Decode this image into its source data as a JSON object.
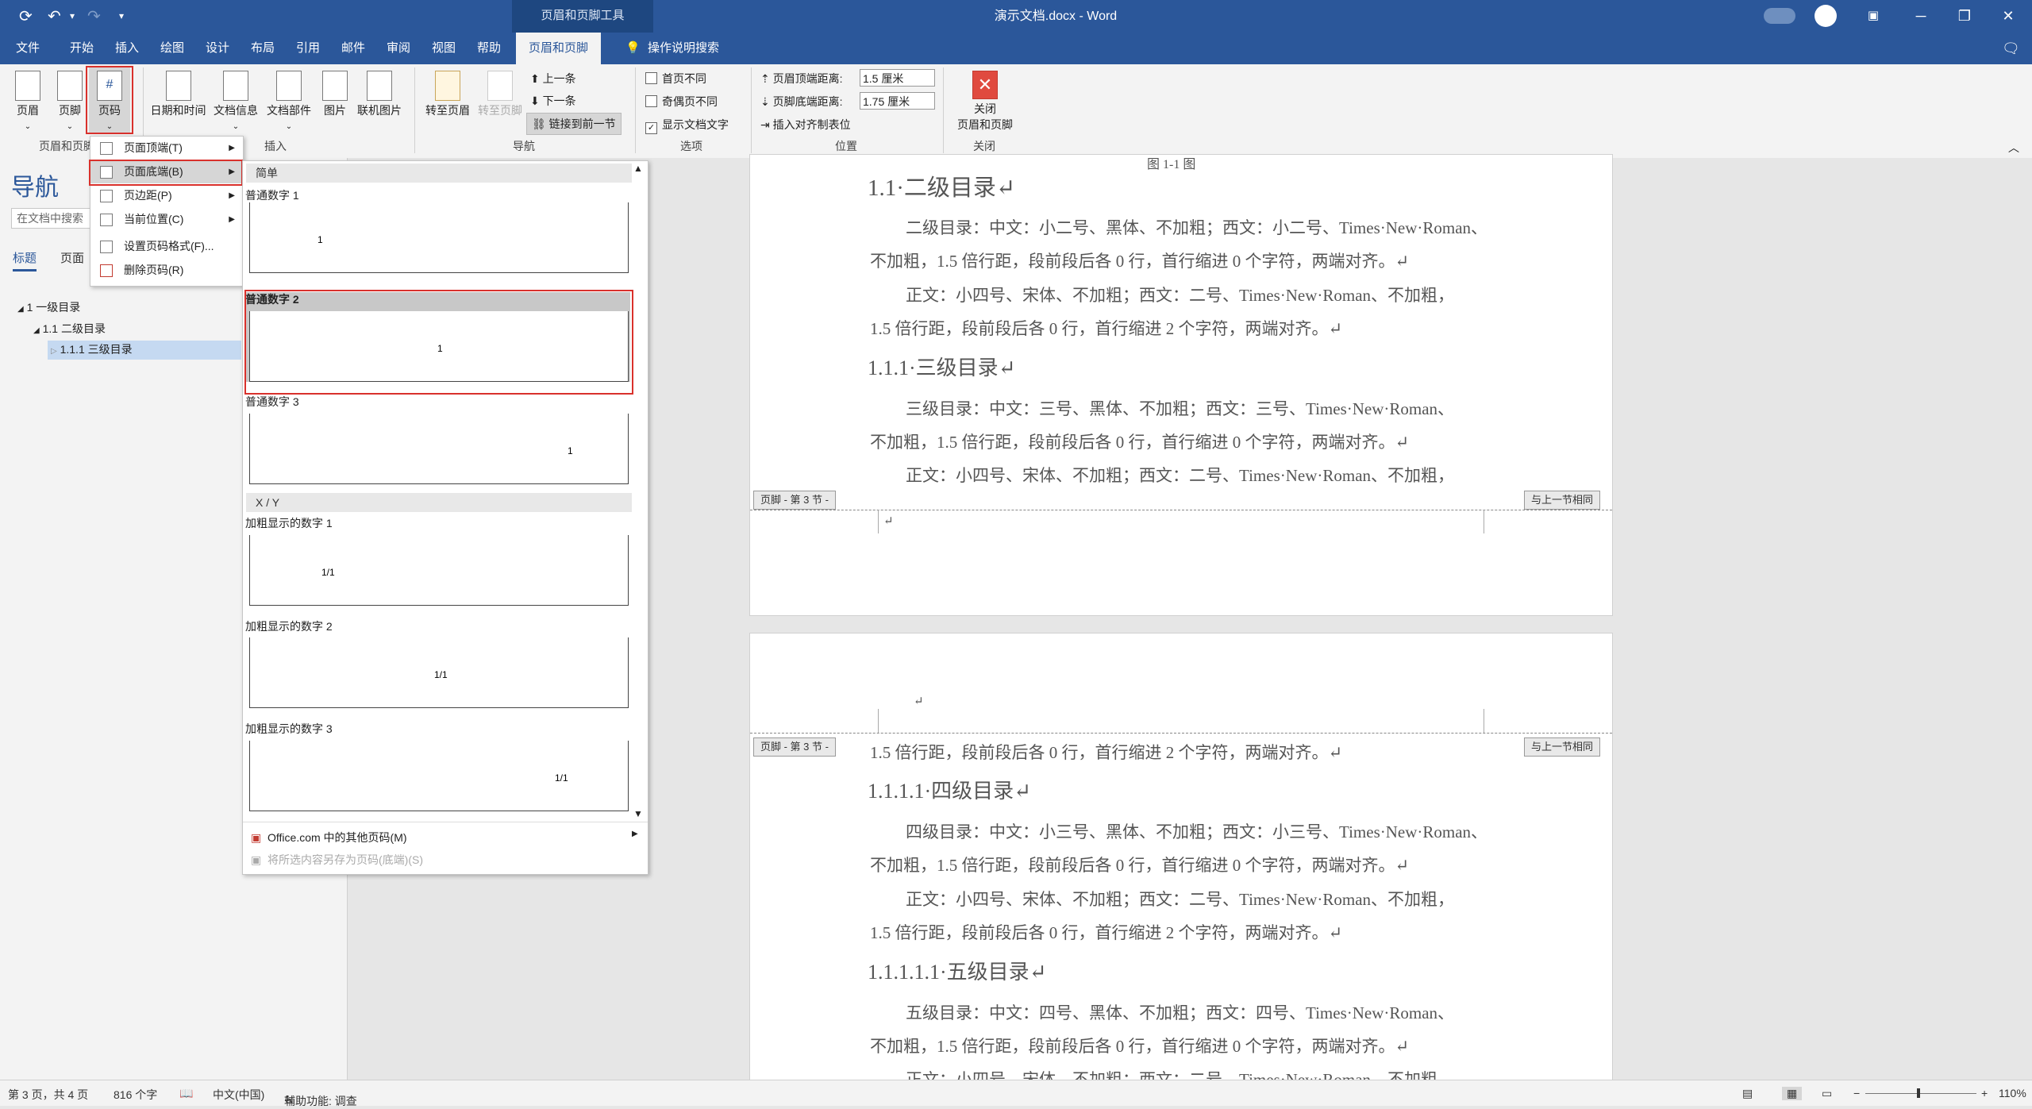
{
  "titlebar": {
    "context_tool": "页眉和页脚工具",
    "doc_title": "演示文档.docx  -  Word"
  },
  "tabs": [
    "文件",
    "开始",
    "插入",
    "绘图",
    "设计",
    "布局",
    "引用",
    "邮件",
    "审阅",
    "视图",
    "帮助",
    "页眉和页脚"
  ],
  "tell_me": "操作说明搜索",
  "ribbon": {
    "hf_group": {
      "header": "页眉",
      "footer": "页脚",
      "page_number": "页码",
      "label": "页眉和页脚"
    },
    "insert_group": {
      "datetime": "日期和时间",
      "docinfo": "文档信息",
      "quickparts": "文档部件",
      "picture": "图片",
      "online_picture": "联机图片",
      "label": "插入"
    },
    "nav_group": {
      "goto_header": "转至页眉",
      "goto_footer": "转至页脚",
      "previous": "上一条",
      "next": "下一条",
      "link_previous": "链接到前一节",
      "label": "导航"
    },
    "options_group": {
      "first_page": "首页不同",
      "odd_even": "奇偶页不同",
      "show_text": "显示文档文字",
      "label": "选项"
    },
    "position_group": {
      "header_dist_label": "页眉顶端距离:",
      "header_dist": "1.5 厘米",
      "footer_dist_label": "页脚底端距离:",
      "footer_dist": "1.75 厘米",
      "align_tab": "插入对齐制表位",
      "label": "位置"
    },
    "close_group": {
      "close_line1": "关闭",
      "close_line2": "页眉和页脚",
      "label": "关闭"
    }
  },
  "nav": {
    "title": "导航",
    "search_placeholder": "在文档中搜索",
    "tabs": [
      "标题",
      "页面"
    ],
    "tree": [
      "1 一级目录",
      "1.1 二级目录",
      "1.1.1 三级目录"
    ]
  },
  "menu": [
    {
      "label": "页面顶端(T)",
      "arrow": true
    },
    {
      "label": "页面底端(B)",
      "arrow": true
    },
    {
      "label": "页边距(P)",
      "arrow": true
    },
    {
      "label": "当前位置(C)",
      "arrow": true
    },
    {
      "label": "设置页码格式(F)...",
      "arrow": false
    },
    {
      "label": "删除页码(R)",
      "arrow": false
    }
  ],
  "gallery": {
    "section_simple": "简单",
    "items": [
      {
        "label": "普通数字 1",
        "num": "1"
      },
      {
        "label": "普通数字 2",
        "num": "1"
      },
      {
        "label": "普通数字 3",
        "num": "1"
      }
    ],
    "section_xy": "X / Y",
    "items_xy": [
      {
        "label": "加粗显示的数字 1",
        "num": "1/1"
      },
      {
        "label": "加粗显示的数字 2",
        "num": "1/1"
      },
      {
        "label": "加粗显示的数字 3",
        "num": "1/1"
      }
    ],
    "more": "Office.com 中的其他页码(M)",
    "save": "将所选内容另存为页码(底端)(S)"
  },
  "doc": {
    "top_cut": "图 1-1 图",
    "h2": "1.1·二级目录↵",
    "p1a": "二级目录：中文：小二号、黑体、不加粗；西文：小二号、Times·New·Roman、",
    "p1b": "不加粗，1.5 倍行距，段前段后各 0 行，首行缩进 0 个字符，两端对齐。↵",
    "p2a": "正文：小四号、宋体、不加粗；西文：二号、Times·New·Roman、不加粗，",
    "p2b": "1.5 倍行距，段前段后各 0 行，首行缩进 2 个字符，两端对齐。↵",
    "h3": "1.1.1·三级目录↵",
    "p3a": "三级目录：中文：三号、黑体、不加粗；西文：三号、Times·New·Roman、",
    "p3b": "不加粗，1.5 倍行距，段前段后各 0 行，首行缩进 0 个字符，两端对齐。↵",
    "p4a": "正文：小四号、宋体、不加粗；西文：二号、Times·New·Roman、不加粗，",
    "footer_tag": "页脚 - 第 3 节 -",
    "same_prev": "与上一节相同",
    "para_mark": "↵",
    "p5": "1.5 倍行距，段前段后各 0 行，首行缩进 2 个字符，两端对齐。↵",
    "h4": "1.1.1.1·四级目录↵",
    "p6a": "四级目录：中文：小三号、黑体、不加粗；西文：小三号、Times·New·Roman、",
    "p6b": "不加粗，1.5 倍行距，段前段后各 0 行，首行缩进 0 个字符，两端对齐。↵",
    "p7a": "正文：小四号、宋体、不加粗；西文：二号、Times·New·Roman、不加粗，",
    "p7b": "1.5 倍行距，段前段后各 0 行，首行缩进 2 个字符，两端对齐。↵",
    "h5": "1.1.1.1.1·五级目录↵",
    "p8a": "五级目录：中文：四号、黑体、不加粗；西文：四号、Times·New·Roman、",
    "p8b": "不加粗，1.5 倍行距，段前段后各 0 行，首行缩进 0 个字符，两端对齐。↵",
    "p9a": "正文：小四号、宋体、不加粗；西文：二号、Times·New·Roman、不加粗，"
  },
  "status": {
    "page": "第 3 页，共 4 页",
    "words": "816 个字",
    "lang": "中文(中国)",
    "access": "辅助功能: 调查",
    "zoom": "110%"
  },
  "colors": {
    "accent": "#2b579a",
    "highlight": "#d9312c",
    "selected": "#c5d9f1"
  }
}
